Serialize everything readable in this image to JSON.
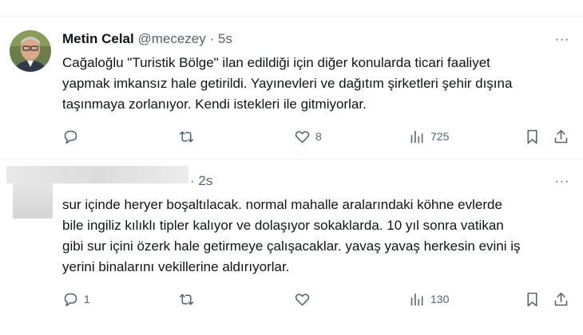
{
  "tweets": [
    {
      "author_name": "Metin Celal",
      "handle": "@mecezey",
      "dot": "·",
      "time": "5s",
      "text": "Cağaloğlu \"Turistik Bölge\" ilan edildiği için diğer konularda ticari faaliyet\nyapmak imkansız hale getirildi. Yayınevleri ve dağıtım şirketleri şehir dışına\ntaşınmaya zorlanıyor. Kendi istekleri ile gitmiyorlar.",
      "more_label": "···",
      "replies": "",
      "retweets": "",
      "likes": "8",
      "views": "725"
    },
    {
      "author_name": "",
      "handle": "",
      "dot": "·",
      "time": "2s",
      "text": "sur içinde heryer boşaltılacak. normal mahalle aralarındaki köhne evlerde\nbile ingiliz kılıklı tipler kalıyor ve dolaşıyor sokaklarda. 10 yıl sonra vatikan\ngibi sur içini özerk hale getirmeye çalışacaklar. yavaş yavaş herkesin evini iş\nyerini binalarını vekillerine aldırıyorlar.",
      "more_label": "···",
      "replies": "1",
      "retweets": "",
      "likes": "",
      "views": "130"
    }
  ],
  "colors": {
    "text": "#0f1419",
    "secondary": "#536471",
    "divider": "#eff3f4"
  },
  "icons": {
    "reply": "reply-icon",
    "retweet": "retweet-icon",
    "like": "like-icon",
    "views": "views-icon",
    "bookmark": "bookmark-icon",
    "share": "share-icon",
    "more": "more-icon"
  }
}
